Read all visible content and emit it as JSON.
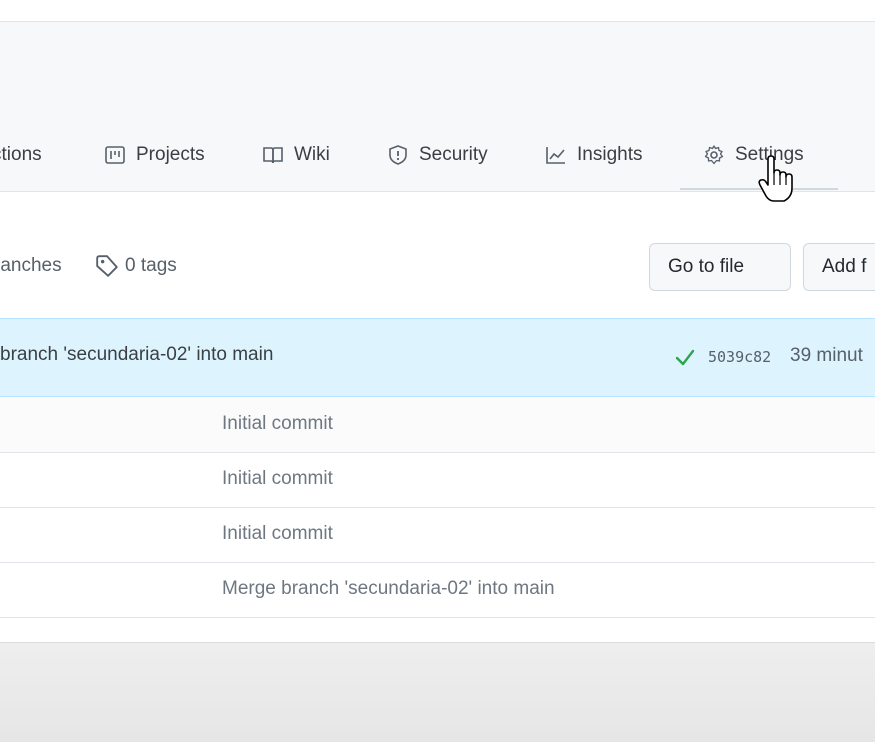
{
  "nav": {
    "tabs": [
      {
        "label": "ctions",
        "icon": "actions-icon"
      },
      {
        "label": "Projects",
        "icon": "project-board-icon"
      },
      {
        "label": "Wiki",
        "icon": "book-icon"
      },
      {
        "label": "Security",
        "icon": "shield-icon"
      },
      {
        "label": "Insights",
        "icon": "graph-icon"
      },
      {
        "label": "Settings",
        "icon": "gear-icon",
        "selected": true
      }
    ]
  },
  "repo": {
    "branches_text": "ranches",
    "tags_text": "0 tags",
    "go_to_file": "Go to file",
    "add_file": "Add f"
  },
  "latest_commit": {
    "message": "branch 'secundaria-02' into main",
    "status": "success",
    "sha": "5039c82",
    "time": "39 minut"
  },
  "files": [
    {
      "message": "Initial commit"
    },
    {
      "message": "Initial commit"
    },
    {
      "message": "Initial commit"
    },
    {
      "message": "Merge branch 'secundaria-02' into main"
    }
  ],
  "colors": {
    "accent_bg": "#ddf4ff",
    "success": "#2da44e",
    "muted_text": "#6e7781"
  }
}
